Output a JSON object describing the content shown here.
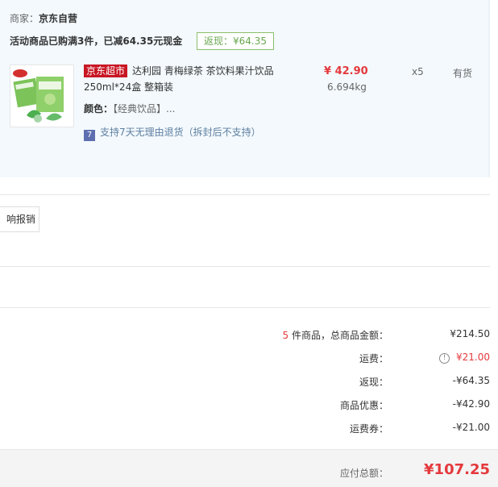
{
  "merchant": {
    "label": "商家：",
    "name": "京东自营"
  },
  "promotion": {
    "text": "活动商品已购满3件，已减64.35元现金",
    "badge": "返现：¥64.35"
  },
  "item": {
    "tag": "京东超市",
    "title": "达利园 青梅绿茶 茶饮料果汁饮品 250ml*24盒 整箱装",
    "color_label": "颜色：",
    "color_value": "【经典饮品】...",
    "return_icon": "7",
    "return_text": "支持7天无理由退货（拆封后不支持）",
    "price": "¥ 42.90",
    "weight": "6.694kg",
    "qty": "x5",
    "stock": "有货",
    "thumb_icon": "product-thumbnail"
  },
  "reimburse_button": "响报销",
  "summary": {
    "count": "5",
    "count_suffix": " 件商品，总商品金额：",
    "goods_total": "¥214.50",
    "shipping_label": "运费：",
    "shipping_value": "¥21.00",
    "rebate_label": "返现：",
    "rebate_value": "-¥64.35",
    "discount_label": "商品优惠：",
    "discount_value": "-¥42.90",
    "coupon_label": "运费券：",
    "coupon_value": "-¥21.00",
    "total_label": "应付总额：",
    "total_value": "¥107.25"
  },
  "colors": {
    "accent": "#e4393c",
    "panel_bg": "#f3f9fd",
    "rebate_green": "#6aa84f"
  }
}
